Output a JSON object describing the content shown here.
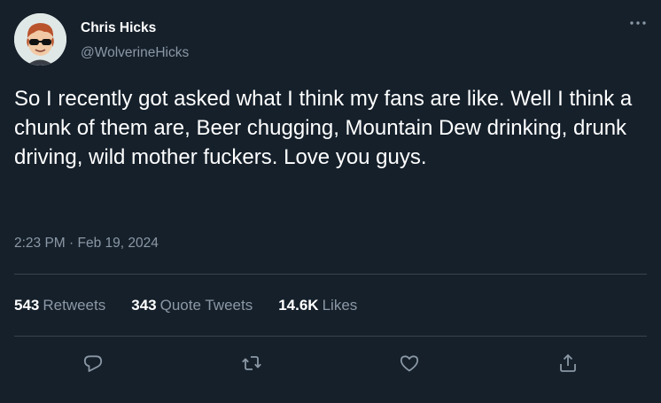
{
  "user": {
    "display_name": "Chris Hicks",
    "handle": "@WolverineHicks",
    "avatar_icon": "cartoon-avatar-sunglasses"
  },
  "tweet": {
    "text": "So I recently got asked what I think my fans are like. Well I think a chunk of them are, Beer chugging, Mountain Dew drinking, drunk driving, wild mother fuckers. Love you guys.",
    "timestamp": "2:23 PM · Feb 19, 2024"
  },
  "stats": {
    "retweets_count": "543",
    "retweets_label": "Retweets",
    "quotes_count": "343",
    "quotes_label": "Quote Tweets",
    "likes_count": "14.6K",
    "likes_label": "Likes"
  },
  "actions": [
    {
      "icon": "reply-icon"
    },
    {
      "icon": "retweet-icon"
    },
    {
      "icon": "like-icon"
    },
    {
      "icon": "share-icon"
    }
  ],
  "colors": {
    "background": "#15202b",
    "primary_text": "#ffffff",
    "secondary_text": "#8b98a5",
    "divider": "#38444d"
  }
}
